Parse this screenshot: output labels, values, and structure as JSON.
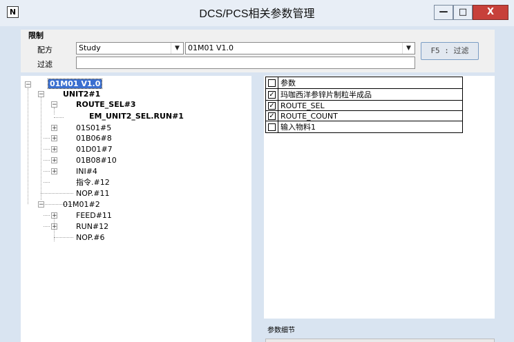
{
  "window": {
    "title": "DCS/PCS相关参数管理",
    "app_icon": "N",
    "min_glyph": "—",
    "max_glyph": "□",
    "close_glyph": "X"
  },
  "filter": {
    "group_label": "限制",
    "recipe_label": "配方",
    "recipe_value": "Study",
    "version_value": "01M01 V1.0",
    "filter_label": "过滤",
    "filter_value": "",
    "f5_button": "F5 : 过滤"
  },
  "tree": {
    "root": "01M01 V1.0",
    "unit": "UNIT2#1",
    "route_sel": "ROUTE_SEL#3",
    "em_run": "EM_UNIT2_SEL.RUN#1",
    "c1": "01S01#5",
    "c2": "01B06#8",
    "c3": "01D01#7",
    "c4": "01B08#10",
    "c5": "INI#4",
    "c6": "指令.#12",
    "c7": "NOP.#11",
    "op2": "01M01#2",
    "d1": "FEED#11",
    "d2": "RUN#12",
    "d3": "NOP.#6"
  },
  "params": {
    "header": {
      "checked": false,
      "label": "参数"
    },
    "rows": [
      {
        "checked": true,
        "label": "玛咖西洋参锌片制粒半成品"
      },
      {
        "checked": true,
        "label": "ROUTE_SEL"
      },
      {
        "checked": true,
        "label": "ROUTE_COUNT"
      },
      {
        "checked": false,
        "label": "输入物料1"
      }
    ]
  },
  "detail": {
    "label": "参数细节"
  },
  "icons": {
    "check": "check-icon",
    "expand": "plus-icon",
    "collapse": "minus-icon",
    "dropdown": "chevron-down-icon"
  },
  "colors": {
    "selection": "#3a6fd0",
    "close_button": "#c7403a",
    "window_bg": "#d9e4f1"
  }
}
